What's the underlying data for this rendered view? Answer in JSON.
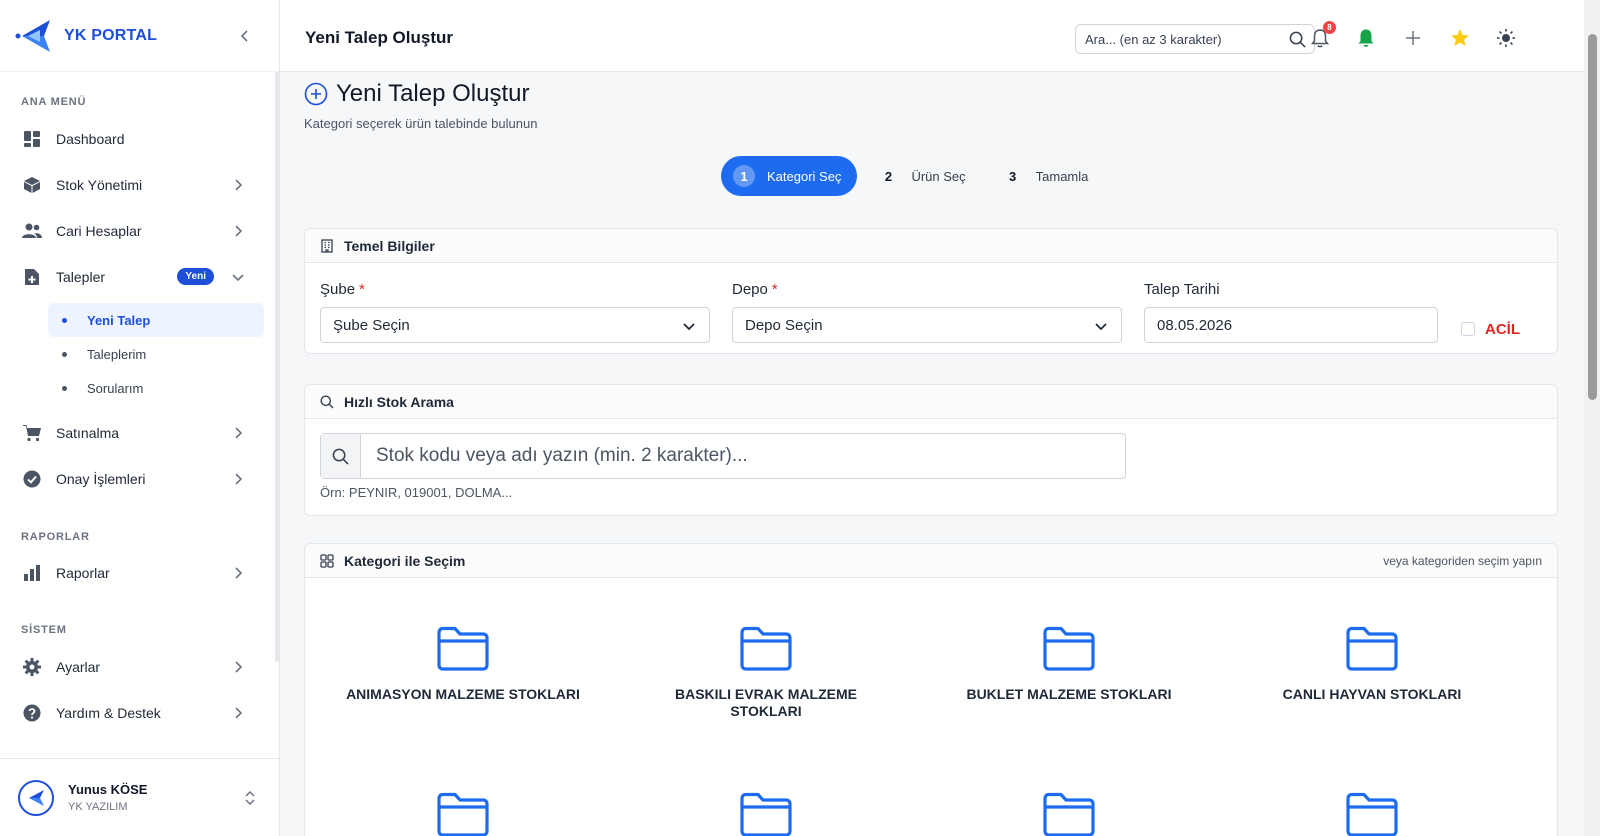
{
  "brand": {
    "name": "YK PORTAL"
  },
  "sidebar": {
    "sections": [
      {
        "title": "ANA MENÜ"
      },
      {
        "title": "RAPORLAR"
      },
      {
        "title": "SİSTEM"
      }
    ],
    "items": [
      {
        "label": "Dashboard"
      },
      {
        "label": "Stok Yönetimi"
      },
      {
        "label": "Cari Hesaplar"
      },
      {
        "label": "Talepler",
        "badge": "Yeni"
      },
      {
        "label": "Satınalma"
      },
      {
        "label": "Onay İşlemleri"
      },
      {
        "label": "Raporlar"
      },
      {
        "label": "Ayarlar"
      },
      {
        "label": "Yardım & Destek"
      }
    ],
    "sub_items": [
      {
        "label": "Yeni Talep",
        "active": true
      },
      {
        "label": "Taleplerim"
      },
      {
        "label": "Sorularım"
      }
    ]
  },
  "user": {
    "name": "Yunus KÖSE",
    "org": "YK YAZILIM"
  },
  "topbar": {
    "title": "Yeni Talep Oluştur",
    "search_placeholder": "Ara... (en az 3 karakter)",
    "notification_count": "8"
  },
  "page": {
    "title": "Yeni Talep Oluştur",
    "subtitle": "Kategori seçerek ürün talebinde bulunun"
  },
  "steps": [
    {
      "num": "1",
      "label": "Kategori Seç",
      "active": true
    },
    {
      "num": "2",
      "label": "Ürün Seç"
    },
    {
      "num": "3",
      "label": "Tamamla"
    }
  ],
  "basic_info": {
    "title": "Temel Bilgiler",
    "branch_label": "Şube",
    "branch_value": "Şube Seçin",
    "depot_label": "Depo",
    "depot_value": "Depo Seçin",
    "date_label": "Talep Tarihi",
    "date_value": "08.05.2026",
    "urgent_label": "ACİL",
    "required_mark": "*"
  },
  "quick_search": {
    "title": "Hızlı Stok Arama",
    "placeholder": "Stok kodu veya adı yazın (min. 2 karakter)...",
    "hint": "Örn: PEYNIR, 019001, DOLMA..."
  },
  "category": {
    "title": "Kategori ile Seçim",
    "hint": "veya kategoriden seçim yapın",
    "items": [
      {
        "label": "ANIMASYON MALZEME STOKLARI"
      },
      {
        "label": "BASKILI EVRAK MALZEME STOKLARI"
      },
      {
        "label": "BUKLET MALZEME STOKLARI"
      },
      {
        "label": "CANLI HAYVAN STOKLARI"
      }
    ]
  },
  "colors": {
    "accent": "#1d6cf0",
    "brand": "#1d4fd8",
    "danger": "#dc2626",
    "folder": "#1d6cf0"
  }
}
